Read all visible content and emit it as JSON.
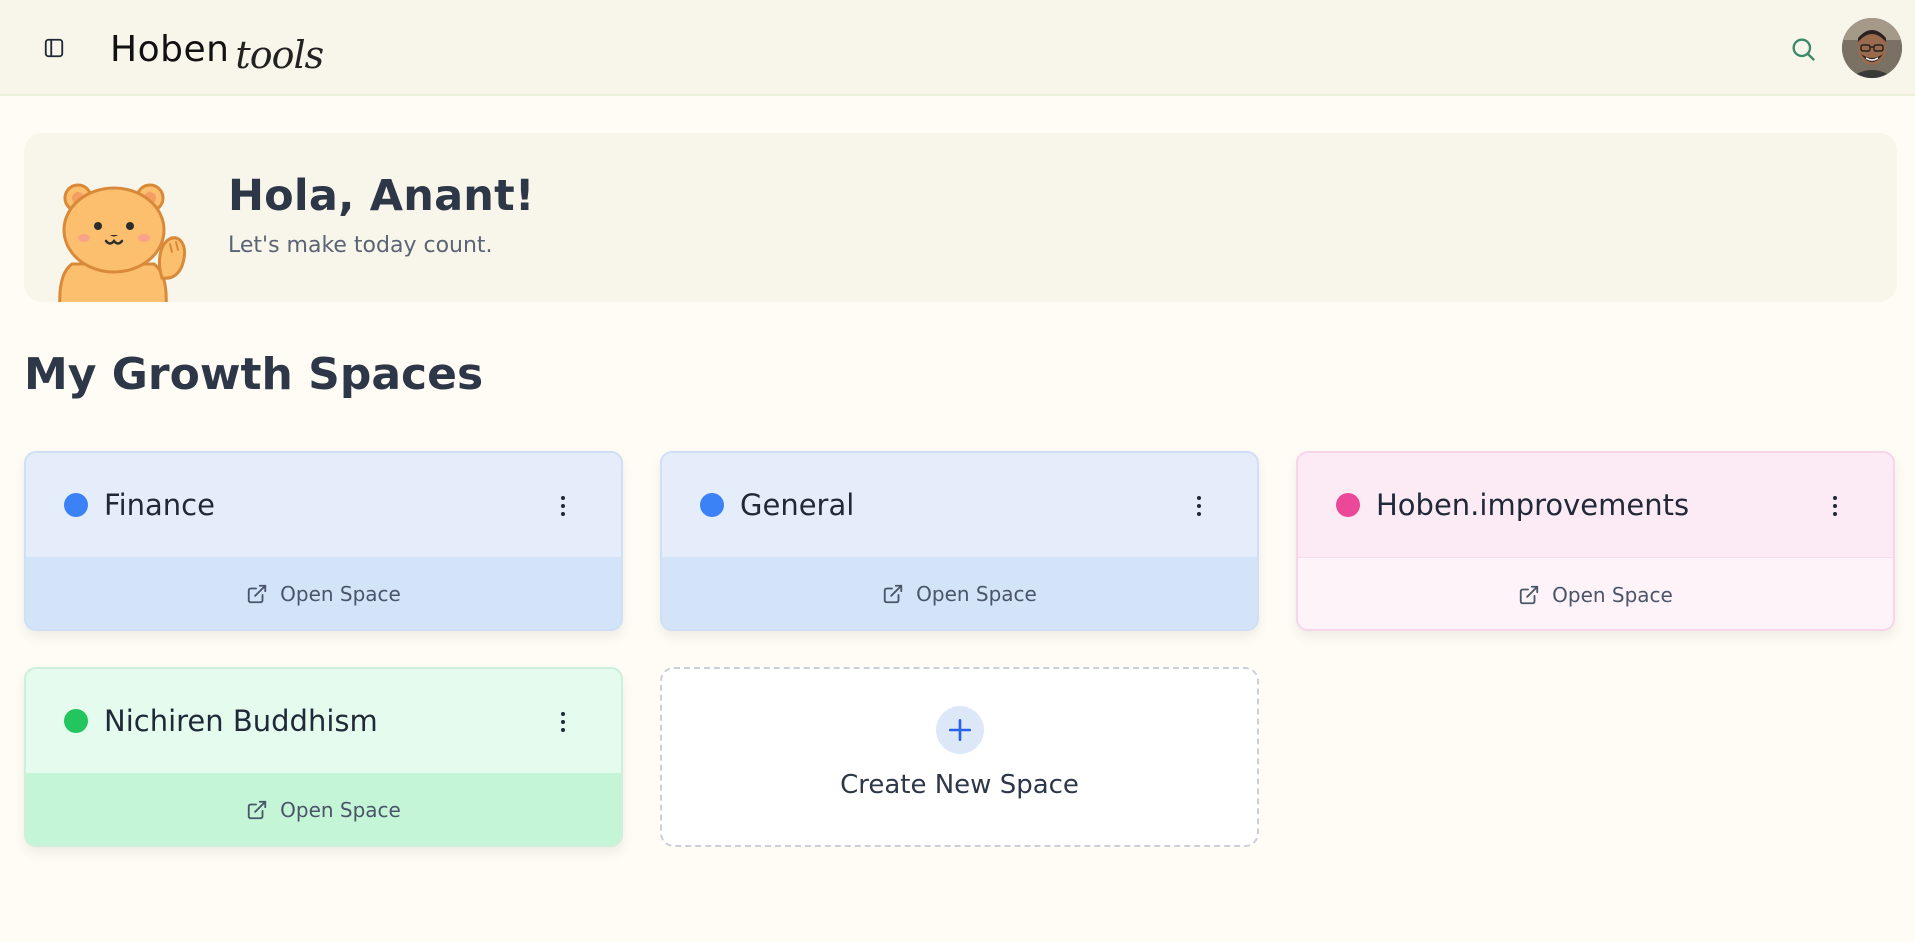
{
  "header": {
    "brand_main": "Hoben",
    "brand_script": "tools",
    "icons": {
      "sidebar_toggle": "sidebar-toggle-icon",
      "search": "search-icon"
    },
    "accent_color": "#3a8a6a"
  },
  "hero": {
    "greeting": "Hola, Anant!",
    "subtitle": "Let's make today count."
  },
  "spaces": {
    "section_title": "My Growth Spaces",
    "items": [
      {
        "name": "Finance",
        "dot_color": "#3b82f6",
        "open_label": "Open Space"
      },
      {
        "name": "General",
        "dot_color": "#3b82f6",
        "open_label": "Open Space"
      },
      {
        "name": "Hoben.improvements",
        "dot_color": "#ec4899",
        "open_label": "Open Space"
      },
      {
        "name": "Nichiren Buddhism",
        "dot_color": "#22c55e",
        "open_label": "Open Space"
      }
    ],
    "create_label": "Create New Space"
  }
}
